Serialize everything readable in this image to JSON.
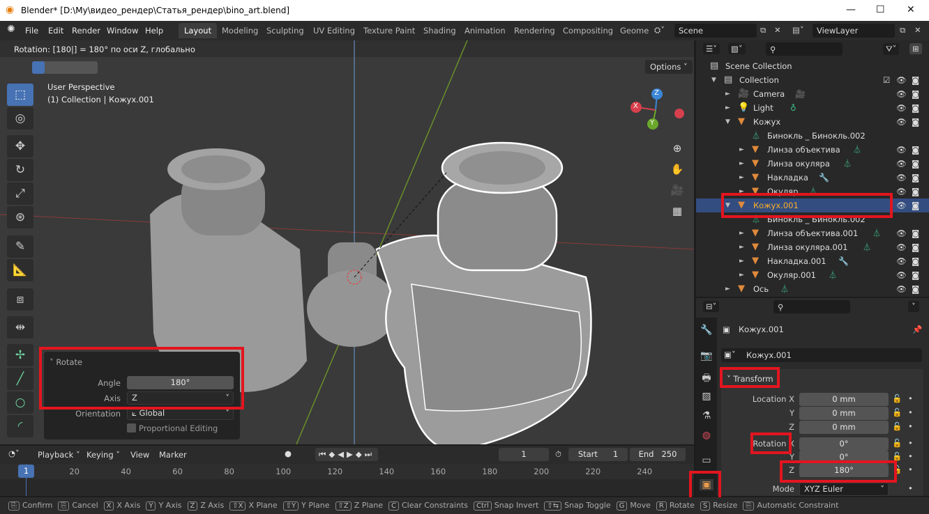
{
  "window": {
    "title": "Blender* [D:\\My\\видео_рендер\\Статья_рендер\\bino_art.blend]",
    "minimize": "—",
    "maximize": "☐",
    "close": "✕"
  },
  "menu": [
    "File",
    "Edit",
    "Render",
    "Window",
    "Help"
  ],
  "workspaces": [
    "Layout",
    "Modeling",
    "Sculpting",
    "UV Editing",
    "Texture Paint",
    "Shading",
    "Animation",
    "Rendering",
    "Compositing",
    "Geome"
  ],
  "scene": "Scene",
  "view_layer": "ViewLayer",
  "viewport": {
    "operator_status": "Rotation: [180|] = 180°  по оси Z, глобально",
    "options": "Options",
    "perspective": "User Perspective",
    "collection_info": "(1) Collection | Кожух.001",
    "gizmo": {
      "x": "X",
      "y": "Y",
      "z": "Z"
    }
  },
  "redo_panel": {
    "title": "Rotate",
    "angle_label": "Angle",
    "angle": "180°",
    "axis_label": "Axis",
    "axis": "Z",
    "orientation_label": "Orientation",
    "orientation": "Global",
    "proportional": "Proportional Editing"
  },
  "timeline": {
    "menus": [
      "Playback",
      "Keying",
      "View",
      "Marker"
    ],
    "current_frame": "1",
    "start_label": "Start",
    "start": "1",
    "end_label": "End",
    "end": "250",
    "ticks": [
      "1",
      "20",
      "40",
      "60",
      "80",
      "100",
      "120",
      "140",
      "160",
      "180",
      "200",
      "220",
      "240"
    ]
  },
  "status_bar": [
    {
      "key": "⎘",
      "label": "Confirm"
    },
    {
      "key": "⎘",
      "label": "Cancel"
    },
    {
      "key": "X",
      "label": "X Axis"
    },
    {
      "key": "Y",
      "label": "Y Axis"
    },
    {
      "key": "Z",
      "label": "Z Axis"
    },
    {
      "key": "⇧X",
      "label": "X Plane"
    },
    {
      "key": "⇧Y",
      "label": "Y Plane"
    },
    {
      "key": "⇧Z",
      "label": "Z Plane"
    },
    {
      "key": "C",
      "label": "Clear Constraints"
    },
    {
      "key": "Ctrl",
      "label": "Snap Invert"
    },
    {
      "key": "⇧⇆",
      "label": "Snap Toggle"
    },
    {
      "key": "G",
      "label": "Move"
    },
    {
      "key": "R",
      "label": "Rotate"
    },
    {
      "key": "S",
      "label": "Resize"
    },
    {
      "key": "⎘",
      "label": "Automatic Constraint"
    }
  ],
  "outliner": {
    "rows": [
      {
        "label": "Scene Collection",
        "indent": 0,
        "icon": "collection",
        "tri": ""
      },
      {
        "label": "Collection",
        "indent": 1,
        "icon": "collection",
        "tri": "▼",
        "check": true
      },
      {
        "label": "Camera",
        "indent": 2,
        "icon": "camera",
        "tri": "►",
        "extra": "camera-data"
      },
      {
        "label": "Light",
        "indent": 2,
        "icon": "light",
        "tri": "►",
        "extra": "light-data"
      },
      {
        "label": "Кожух",
        "indent": 2,
        "icon": "mesh",
        "tri": "▼"
      },
      {
        "label": "Бинокль _ Бинокль.002",
        "indent": 3,
        "icon": "mesh-data",
        "tri": "",
        "novis": true
      },
      {
        "label": "Линза объектива",
        "indent": 3,
        "icon": "mesh",
        "tri": "►",
        "extra": "mesh-data"
      },
      {
        "label": "Линза окуляра",
        "indent": 3,
        "icon": "mesh",
        "tri": "►",
        "extra": "mesh-data"
      },
      {
        "label": "Накладка",
        "indent": 3,
        "icon": "mesh",
        "tri": "►",
        "extra": "modifier"
      },
      {
        "label": "Окуляр",
        "indent": 3,
        "icon": "mesh",
        "tri": "►",
        "extra": "mesh-data"
      },
      {
        "label": "Кожух.001",
        "indent": 2,
        "icon": "mesh",
        "tri": "▼",
        "selected": true
      },
      {
        "label": "Бинокль _ Бинокль.002",
        "indent": 3,
        "icon": "mesh-data",
        "tri": "",
        "novis": true
      },
      {
        "label": "Линза объектива.001",
        "indent": 3,
        "icon": "mesh",
        "tri": "►",
        "extra": "mesh-data"
      },
      {
        "label": "Линза окуляра.001",
        "indent": 3,
        "icon": "mesh",
        "tri": "►",
        "extra": "mesh-data"
      },
      {
        "label": "Накладка.001",
        "indent": 3,
        "icon": "mesh",
        "tri": "►",
        "extra": "modifier"
      },
      {
        "label": "Окуляр.001",
        "indent": 3,
        "icon": "mesh",
        "tri": "►",
        "extra": "mesh-data"
      },
      {
        "label": "Ось",
        "indent": 2,
        "icon": "mesh",
        "tri": "►",
        "extra": "mesh-data"
      }
    ]
  },
  "properties": {
    "object_name": "Кожух.001",
    "object_field": "Кожух.001",
    "transform_title": "Transform",
    "location": [
      {
        "label": "Location X",
        "value": "0 mm"
      },
      {
        "label": "Y",
        "value": "0 mm"
      },
      {
        "label": "Z",
        "value": "0 mm"
      }
    ],
    "rotation": [
      {
        "label": "Rotation X",
        "value": "0°"
      },
      {
        "label": "Y",
        "value": "0°"
      },
      {
        "label": "Z",
        "value": "180°"
      }
    ],
    "mode_label": "Mode",
    "mode": "XYZ Euler"
  },
  "colors": {
    "accent": "#4772b3",
    "highlight": "#e3151f",
    "selected_row": "#334d80",
    "object_orange": "#e08a3c"
  }
}
